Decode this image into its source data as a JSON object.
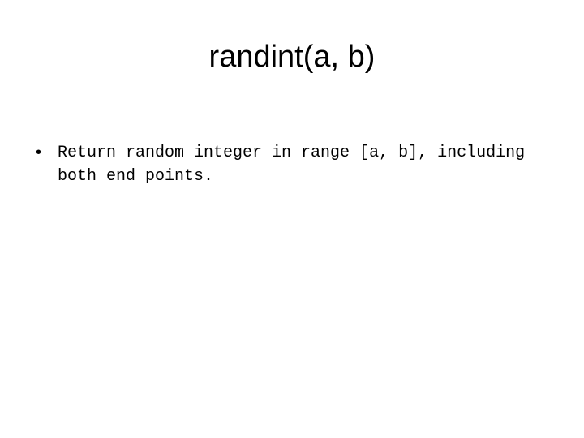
{
  "slide": {
    "title": "randint(a, b)",
    "bullets": [
      {
        "marker": "•",
        "text": "Return random integer in range [a, b], including both end points."
      }
    ]
  }
}
